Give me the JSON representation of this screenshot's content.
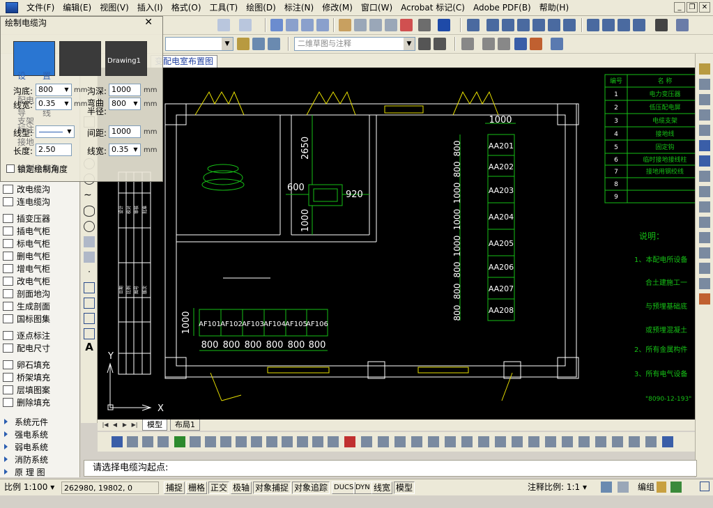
{
  "menubar": {
    "items": [
      "文件(F)",
      "编辑(E)",
      "视图(V)",
      "插入(I)",
      "格式(O)",
      "工具(T)",
      "绘图(D)",
      "标注(N)",
      "修改(M)",
      "窗口(W)",
      "Acrobat 标记(C)",
      "Adobe PDF(B)",
      "帮助(H)"
    ],
    "window_buttons": [
      "_",
      "❐",
      "✕"
    ]
  },
  "toolbar2": {
    "style_combo": "二维草图与注释"
  },
  "dialog": {
    "title": "绘制电缆沟",
    "close": "✕",
    "thumb_label": "Drawing1",
    "left_depth_label": "沟底:",
    "left_depth_value": "800",
    "depth_label": "沟深:",
    "depth_value": "1000",
    "mm": "mm",
    "line_width_label": "线宽:",
    "line_width_value": "0.35",
    "bend_radius_label": "弯曲半径:",
    "bend_radius_value": "800",
    "linetype_label": "线型:",
    "spacing_label": "间距:",
    "spacing_value": "1000",
    "length_label": "长度:",
    "length_value": "2.50",
    "line_width2_label": "线宽:",
    "line_width2_value": "0.35",
    "angle_label": "锁定绘制角度",
    "overlay_words": [
      "设",
      "置",
      "配电",
      "导",
      "线",
      "支架",
      "标注",
      "接地",
      "绘制电缆沟"
    ]
  },
  "leftpanel": {
    "items": [
      "改电缆沟",
      "连电缆沟",
      "插变压器",
      "插电气柜",
      "标电气柜",
      "删电气柜",
      "增电气柜",
      "改电气柜",
      "剖面地沟",
      "生成剖面",
      "国标图集",
      "逐点标注",
      "配电尺寸",
      "卵石填充",
      "桥架填充",
      "层填图案",
      "删除填充"
    ],
    "sections": [
      "系统元件",
      "强电系统",
      "弱电系统",
      "消防系统",
      "原 理 图"
    ]
  },
  "doc_tab": "变配电室布置图",
  "drawing": {
    "cabinet_labels": [
      "AA201",
      "AA202",
      "AA203",
      "AA204",
      "AA205",
      "AA206",
      "AA207",
      "AA208"
    ],
    "cabinet_dims": [
      "800",
      "800",
      "1000",
      "1000",
      "1000",
      "800",
      "800",
      "800"
    ],
    "top_dim": "1000",
    "af_labels": [
      "AF101",
      "AF102",
      "AF103",
      "AF104",
      "AF105",
      "AF106"
    ],
    "af_dims": [
      "800",
      "800",
      "800",
      "800",
      "800",
      "800"
    ],
    "af_height": "1000",
    "dim_2650": "2650",
    "dim_600": "600",
    "dim_920": "920",
    "dim_1000v": "1000",
    "axis_y": "Y",
    "axis_x": "X",
    "legend_header": [
      "编号",
      "名  称"
    ],
    "legend_rows": [
      {
        "no": "1",
        "name": "电力变压器"
      },
      {
        "no": "2",
        "name": "低压配电屏"
      },
      {
        "no": "3",
        "name": "电缆支架"
      },
      {
        "no": "4",
        "name": "接地线"
      },
      {
        "no": "5",
        "name": "固定钩"
      },
      {
        "no": "6",
        "name": "临时接地接线柱"
      },
      {
        "no": "7",
        "name": "接地用钢绞线"
      },
      {
        "no": "8",
        "name": ""
      },
      {
        "no": "9",
        "name": ""
      }
    ],
    "notes_title": "说明：",
    "notes": [
      "1、本配电所设备",
      "合土建施工一",
      "与预埋基础底",
      "或预埋混凝土",
      "2、所有金属构件",
      "3、所有电气设备",
      "\"8090-12-193\""
    ],
    "title_block_labels": [
      "设计",
      "校对",
      "审核",
      "批准",
      "日期",
      "比例",
      "图号",
      "版次"
    ]
  },
  "layout_tabs": {
    "model": "模型",
    "layout1": "布局1"
  },
  "command_line": "请选择电缆沟起点:",
  "statusbar": {
    "scale": "比例 1:100 ▾",
    "coords": "262980, 19802, 0",
    "buttons": [
      "捕捉",
      "栅格",
      "正交",
      "极轴",
      "对象捕捉",
      "对象追踪",
      "DUCS",
      "DYN",
      "线宽",
      "模型"
    ],
    "annotation_scale": "注释比例: 1:1 ▾",
    "right_label": "编组"
  },
  "colors": {
    "green": "#16c016",
    "white": "#ffffff",
    "yellow": "#e8e000",
    "accent_blue": "#1f3fa0"
  }
}
